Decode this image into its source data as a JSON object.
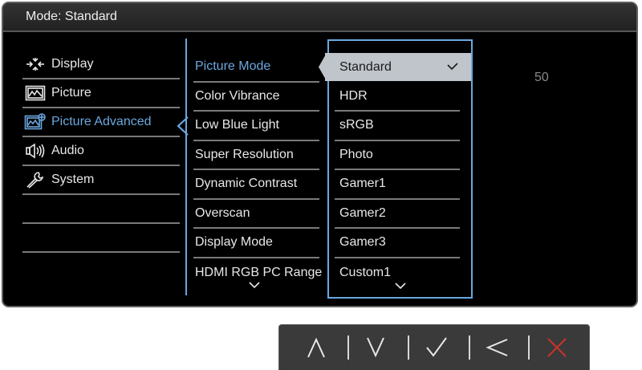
{
  "osd": {
    "title": "Mode: Standard",
    "accent_color": "#6aa7df",
    "main_menu": [
      {
        "label": "Display",
        "icon": "display-icon",
        "active": false
      },
      {
        "label": "Picture",
        "icon": "picture-icon",
        "active": false
      },
      {
        "label": "Picture Advanced",
        "icon": "picture-advanced-icon",
        "active": true
      },
      {
        "label": "Audio",
        "icon": "audio-icon",
        "active": false
      },
      {
        "label": "System",
        "icon": "wrench-icon",
        "active": false
      }
    ],
    "sub_menu": [
      {
        "label": "Picture Mode",
        "active": true
      },
      {
        "label": "Color Vibrance",
        "active": false
      },
      {
        "label": "Low Blue Light",
        "active": false
      },
      {
        "label": "Super Resolution",
        "active": false
      },
      {
        "label": "Dynamic Contrast",
        "active": false
      },
      {
        "label": "Overscan",
        "active": false
      },
      {
        "label": "Display Mode",
        "active": false
      },
      {
        "label": "HDMI RGB PC Range",
        "active": false
      }
    ],
    "options": [
      {
        "label": "Standard",
        "selected": true
      },
      {
        "label": "HDR",
        "selected": false
      },
      {
        "label": "sRGB",
        "selected": false
      },
      {
        "label": "Photo",
        "selected": false
      },
      {
        "label": "Gamer1",
        "selected": false
      },
      {
        "label": "Gamer2",
        "selected": false
      },
      {
        "label": "Gamer3",
        "selected": false
      },
      {
        "label": "Custom1",
        "selected": false
      }
    ],
    "value": "50"
  },
  "hotkeys": [
    {
      "name": "up-key",
      "icon": "caret-up-icon"
    },
    {
      "name": "down-key",
      "icon": "caret-down-icon"
    },
    {
      "name": "ok-key",
      "icon": "check-icon"
    },
    {
      "name": "back-key",
      "icon": "angle-left-icon"
    },
    {
      "name": "exit-key",
      "icon": "close-icon",
      "color": "#c8332b"
    }
  ]
}
